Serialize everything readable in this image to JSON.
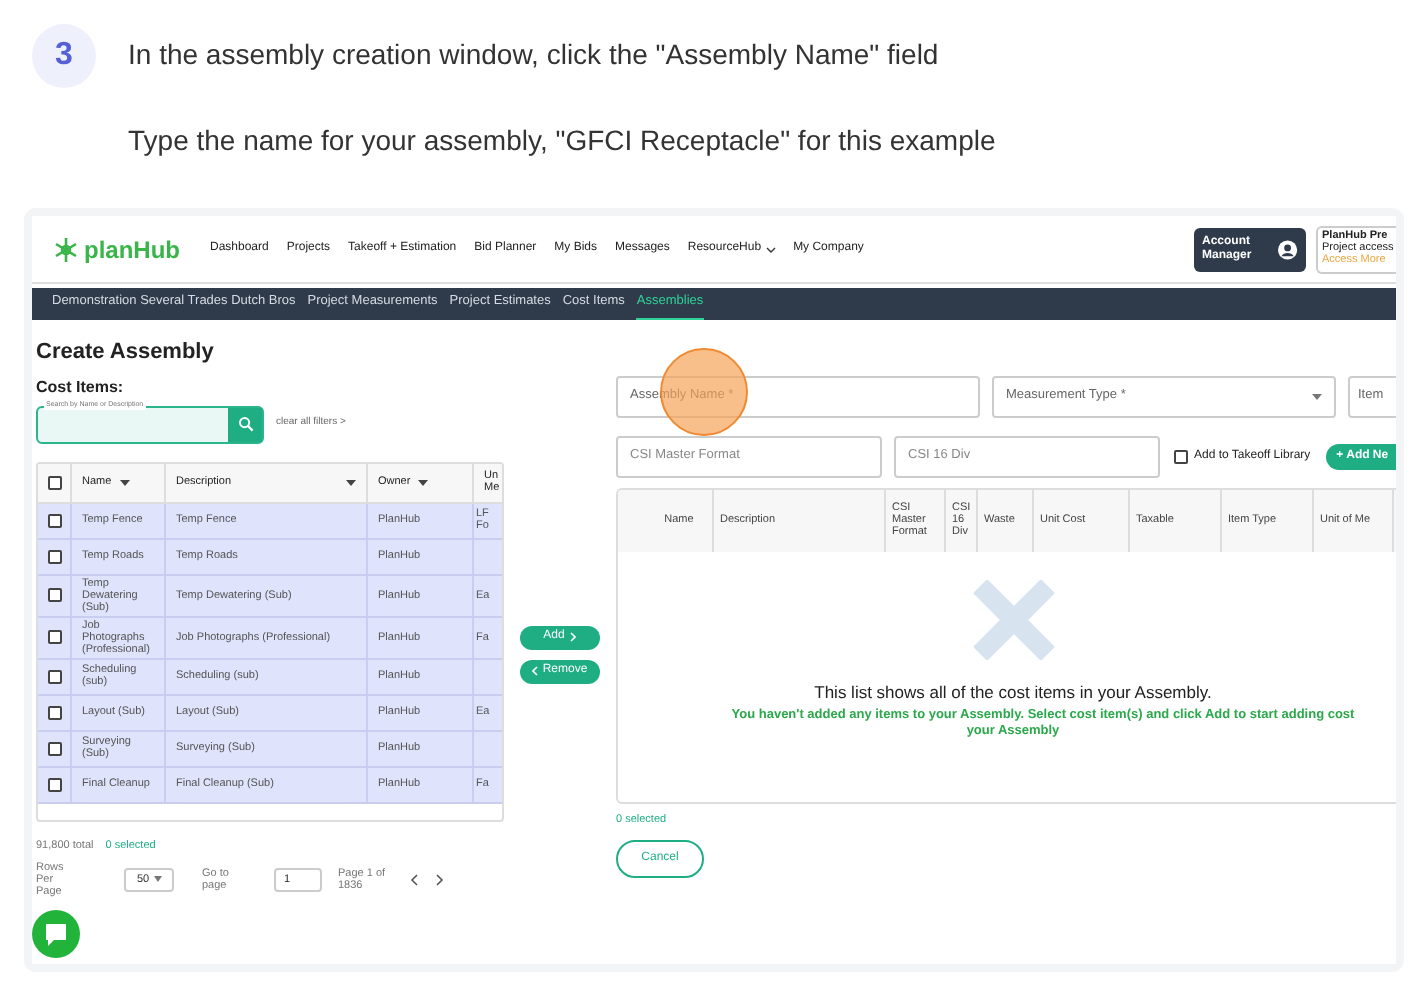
{
  "step": {
    "number": "3",
    "instruction": "In the assembly creation window, click the \"Assembly Name\" field",
    "detail": "Type the name for your assembly, \"GFCI Receptacle\" for this example"
  },
  "app": {
    "logo": "planHub",
    "nav": [
      "Dashboard",
      "Projects",
      "Takeoff + Estimation",
      "Bid Planner",
      "My Bids",
      "Messages",
      "ResourceHub",
      "My Company"
    ],
    "account_button": "Account Manager",
    "premium": {
      "title": "PlanHub Pre",
      "line": "Project access",
      "link": "Access More"
    },
    "subnav": [
      {
        "label": "Demonstration Several Trades Dutch Bros",
        "selected": false
      },
      {
        "label": "Project Measurements",
        "selected": false
      },
      {
        "label": "Project Estimates",
        "selected": false
      },
      {
        "label": "Cost Items",
        "selected": false
      },
      {
        "label": "Assemblies",
        "selected": true
      }
    ],
    "page_title": "Create Assembly",
    "cost_items": {
      "heading": "Cost Items:",
      "search_label": "Search by Name or Description",
      "clear_filters": "clear all filters >",
      "select_all_checked": false,
      "columns": [
        "Name",
        "Description",
        "Owner",
        "Un Me"
      ],
      "rows": [
        {
          "name": "Temp Fence",
          "description": "Temp Fence",
          "owner": "PlanHub",
          "column_4": "LF Fo",
          "checked": false,
          "selected": true
        },
        {
          "name": "Temp Roads",
          "description": "Temp Roads",
          "owner": "PlanHub",
          "column_4": "",
          "checked": false,
          "selected": true
        },
        {
          "name": "Temp Dewatering (Sub)",
          "description": "Temp Dewatering (Sub)",
          "owner": "PlanHub",
          "column_4": "Ea",
          "checked": false,
          "selected": true
        },
        {
          "name": "Job Photographs (Professional)",
          "description": "Job Photographs (Professional)",
          "owner": "PlanHub",
          "column_4": "Fa",
          "checked": false,
          "selected": true
        },
        {
          "name": "Scheduling (sub)",
          "description": "Scheduling (sub)",
          "owner": "PlanHub",
          "column_4": "",
          "checked": false,
          "selected": true
        },
        {
          "name": "Layout (Sub)",
          "description": "Layout (Sub)",
          "owner": "PlanHub",
          "column_4": "Ea",
          "checked": false,
          "selected": true
        },
        {
          "name": "Surveying (Sub)",
          "description": "Surveying (Sub)",
          "owner": "PlanHub",
          "column_4": "",
          "checked": false,
          "selected": true
        },
        {
          "name": "Final Cleanup",
          "description": "Final Cleanup (Sub)",
          "owner": "PlanHub",
          "column_4": "Fa",
          "checked": false,
          "selected": true
        }
      ],
      "total": "91,800 total",
      "selected_count": "0 selected",
      "rows_per_page_label": "Rows Per Page",
      "rows_per_page": "50",
      "go_to_label": "Go to page",
      "page_value": "1",
      "page_info": "Page 1 of 1836"
    },
    "add_button": "Add",
    "remove_button": "Remove",
    "form": {
      "fields": [
        {
          "placeholder": "Assembly Name *",
          "dropdown": false
        },
        {
          "placeholder": "Measurement Type *",
          "dropdown": true
        },
        {
          "placeholder": "Item",
          "dropdown": false
        }
      ],
      "fields_2": [
        {
          "placeholder": "CSI Master Format"
        },
        {
          "placeholder": "CSI 16 Div"
        }
      ],
      "takeoff_checkbox": {
        "label": "Add to Takeoff Library",
        "checked": false
      },
      "add_new": "+ Add Ne"
    },
    "assembly_table": {
      "columns": [
        "Name",
        "Description",
        "CSI Master Format",
        "CSI 16 Div",
        "Waste",
        "Unit Cost",
        "Taxable",
        "Item Type",
        "Unit of Me"
      ],
      "empty_title": "This list shows all of the cost items in your Assembly.",
      "empty_hint": [
        "You haven't added any items to your Assembly. Select cost item(s) and click Add to start adding cost",
        "your Assembly"
      ]
    },
    "assembly_selected": "0 selected",
    "cancel": "Cancel"
  }
}
